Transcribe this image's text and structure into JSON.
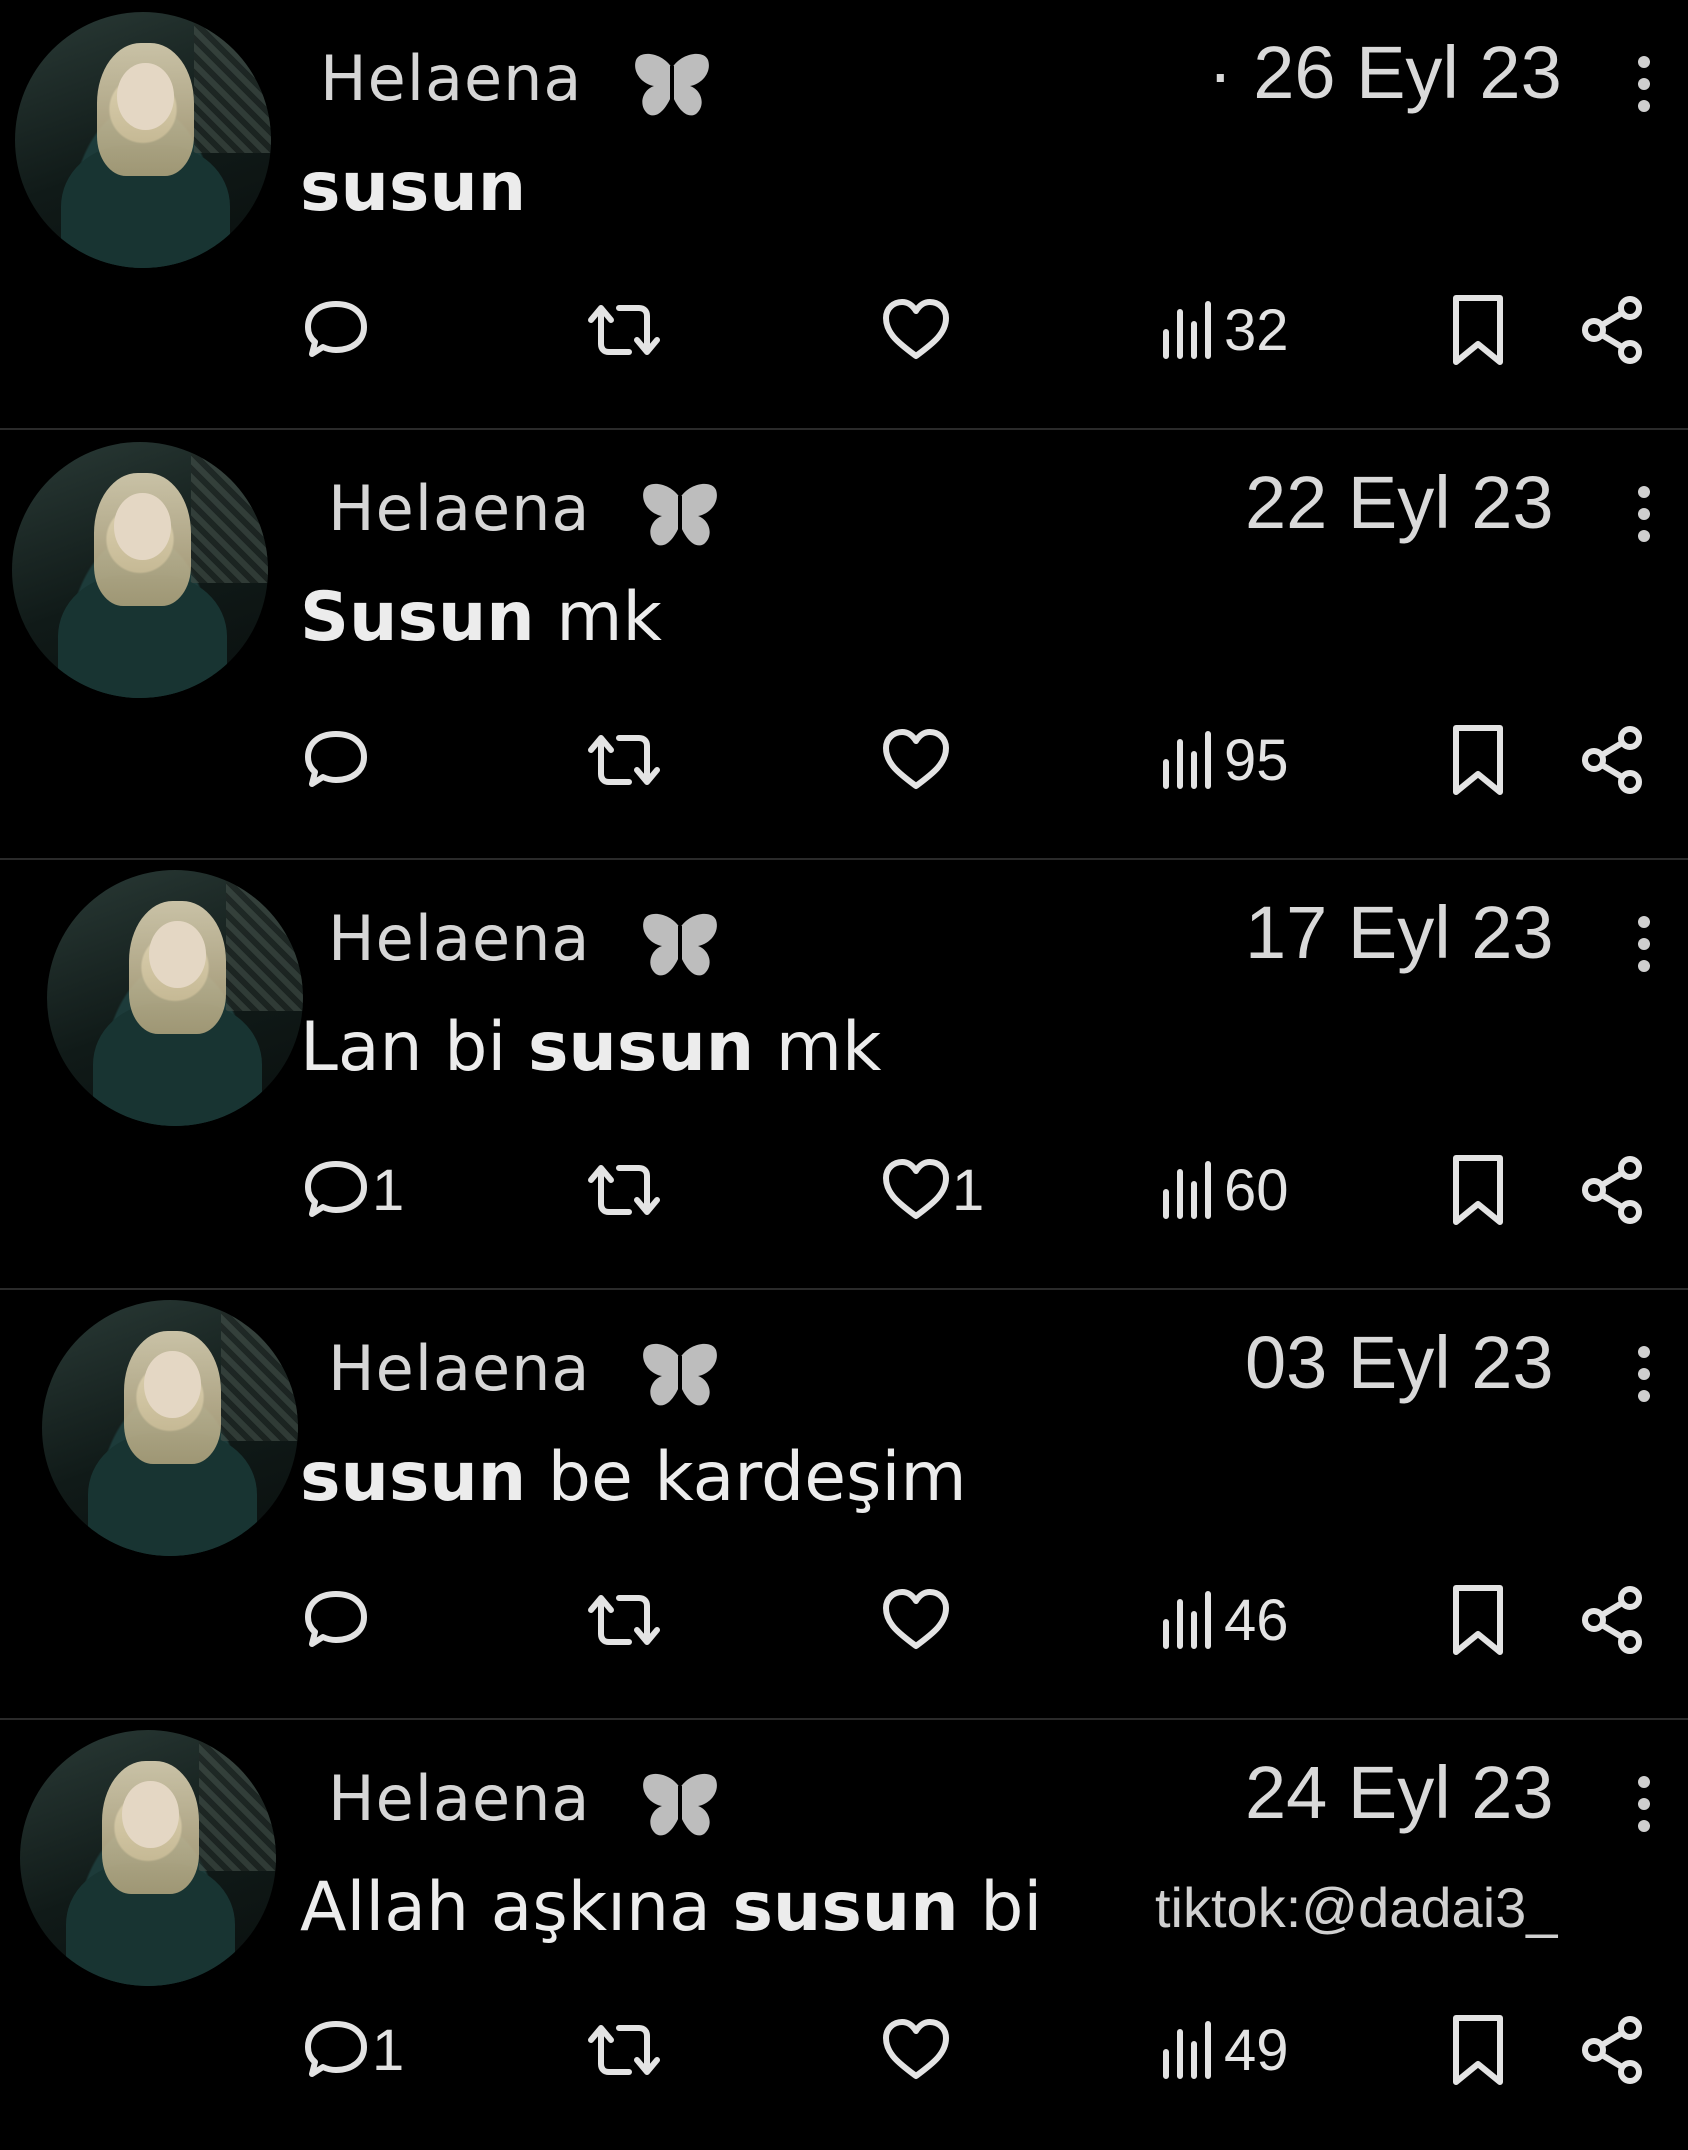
{
  "posts": [
    {
      "author": "Helaena",
      "date": "· 26 Eyl 23",
      "text_parts": [
        {
          "t": "susun",
          "b": true
        }
      ],
      "replies": "",
      "likes": "",
      "views": "32"
    },
    {
      "author": "Helaena",
      "date": "22 Eyl 23",
      "text_parts": [
        {
          "t": "Susun",
          "b": true
        },
        {
          "t": " mk",
          "b": false
        }
      ],
      "replies": "",
      "likes": "",
      "views": "95"
    },
    {
      "author": "Helaena",
      "date": "17 Eyl 23",
      "text_parts": [
        {
          "t": "Lan bi ",
          "b": false
        },
        {
          "t": "susun",
          "b": true
        },
        {
          "t": " mk",
          "b": false
        }
      ],
      "replies": "1",
      "likes": "1",
      "views": "60"
    },
    {
      "author": "Helaena",
      "date": "03 Eyl 23",
      "text_parts": [
        {
          "t": "susun",
          "b": true
        },
        {
          "t": " be kardeşim",
          "b": false
        }
      ],
      "replies": "",
      "likes": "",
      "views": "46"
    },
    {
      "author": "Helaena",
      "date": "24 Eyl 23",
      "text_parts": [
        {
          "t": "Allah aşkına ",
          "b": false
        },
        {
          "t": "susun",
          "b": true
        },
        {
          "t": " bi",
          "b": false
        }
      ],
      "replies": "1",
      "likes": "",
      "views": "49"
    }
  ],
  "icons": {
    "verified": "butterfly-icon",
    "reply": "reply-icon",
    "repost": "repost-icon",
    "like": "heart-icon",
    "views": "views-icon",
    "bookmark": "bookmark-icon",
    "share": "share-icon",
    "more": "more-icon"
  },
  "watermark": "tiktok:@dadai3_"
}
